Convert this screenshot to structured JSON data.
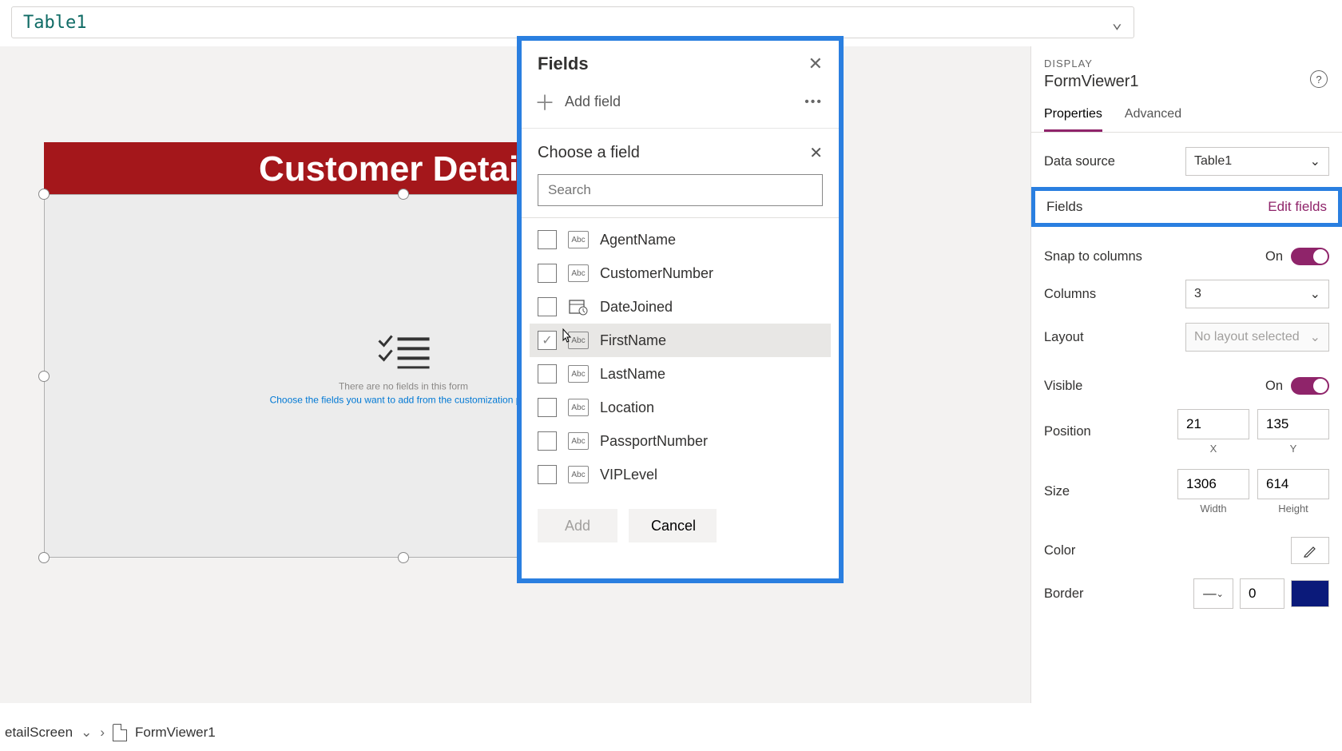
{
  "formula": {
    "value": "Table1"
  },
  "canvas": {
    "header_title": "Customer Details",
    "empty_line1": "There are no fields in this form",
    "empty_line2": "Choose the fields you want to add from the customization pane"
  },
  "fields_panel": {
    "title": "Fields",
    "add_field": "Add field",
    "choose_title": "Choose a field",
    "search_placeholder": "Search",
    "fields": [
      {
        "name": "AgentName",
        "type": "text",
        "checked": false
      },
      {
        "name": "CustomerNumber",
        "type": "text",
        "checked": false
      },
      {
        "name": "DateJoined",
        "type": "date",
        "checked": false
      },
      {
        "name": "FirstName",
        "type": "text",
        "checked": true,
        "hover": true
      },
      {
        "name": "LastName",
        "type": "text",
        "checked": false
      },
      {
        "name": "Location",
        "type": "text",
        "checked": false
      },
      {
        "name": "PassportNumber",
        "type": "text",
        "checked": false
      },
      {
        "name": "VIPLevel",
        "type": "text",
        "checked": false
      }
    ],
    "add_btn": "Add",
    "cancel_btn": "Cancel"
  },
  "props": {
    "display_label": "DISPLAY",
    "control_name": "FormViewer1",
    "tabs": {
      "properties": "Properties",
      "advanced": "Advanced"
    },
    "data_source_label": "Data source",
    "data_source_value": "Table1",
    "fields_label": "Fields",
    "edit_fields": "Edit fields",
    "snap_label": "Snap to columns",
    "snap_value": "On",
    "columns_label": "Columns",
    "columns_value": "3",
    "layout_label": "Layout",
    "layout_value": "No layout selected",
    "visible_label": "Visible",
    "visible_value": "On",
    "position_label": "Position",
    "pos_x": "21",
    "pos_y": "135",
    "x_label": "X",
    "y_label": "Y",
    "size_label": "Size",
    "size_w": "1306",
    "size_h": "614",
    "w_label": "Width",
    "h_label": "Height",
    "color_label": "Color",
    "border_label": "Border",
    "border_width": "0"
  },
  "breadcrumb": {
    "screen": "etailScreen",
    "control": "FormViewer1"
  }
}
